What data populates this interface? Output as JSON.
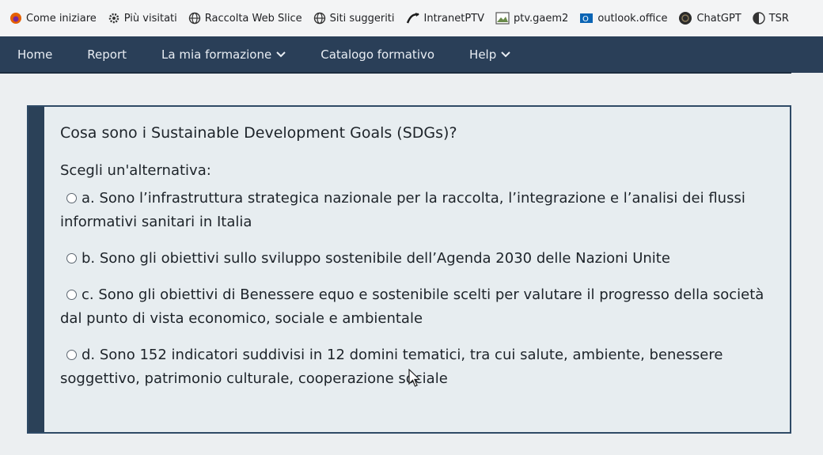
{
  "bookmarks": [
    {
      "label": "Come iniziare",
      "icon": "firefox-icon"
    },
    {
      "label": "Più visitati",
      "icon": "gear-icon"
    },
    {
      "label": "Raccolta Web Slice",
      "icon": "globe-icon"
    },
    {
      "label": "Siti suggeriti",
      "icon": "globe-icon"
    },
    {
      "label": "IntranetPTV",
      "icon": "intranet-icon"
    },
    {
      "label": "ptv.gaem2",
      "icon": "image-icon"
    },
    {
      "label": "outlook.office",
      "icon": "outlook-icon"
    },
    {
      "label": "ChatGPT",
      "icon": "chatgpt-icon"
    },
    {
      "label": "TSR",
      "icon": "tsr-icon"
    }
  ],
  "nav": {
    "home": "Home",
    "report": "Report",
    "formazione": "La mia formazione",
    "catalogo": "Catalogo formativo",
    "help": "Help"
  },
  "quiz": {
    "question": "Cosa sono i Sustainable Development Goals (SDGs)?",
    "prompt": "Scegli un'alternativa:",
    "options": [
      "a. Sono l’infrastruttura strategica nazionale per la raccolta, l’integrazione e l’analisi dei flussi informativi sanitari in Italia",
      "b. Sono gli obiettivi sullo sviluppo sostenibile dell’Agenda 2030 delle Nazioni Unite",
      "c. Sono gli obiettivi di Benessere equo e sostenibile scelti per valutare il progresso della società dal punto di vista economico, sociale e ambientale",
      "d. Sono 152 indicatori suddivisi in 12 domini tematici, tra cui salute, ambiente, benessere soggettivo, patrimonio culturale, cooperazione sociale"
    ]
  },
  "colors": {
    "navbar": "#2a3f58",
    "card_border": "#2f4a66",
    "card_bg": "#e7edf0"
  }
}
